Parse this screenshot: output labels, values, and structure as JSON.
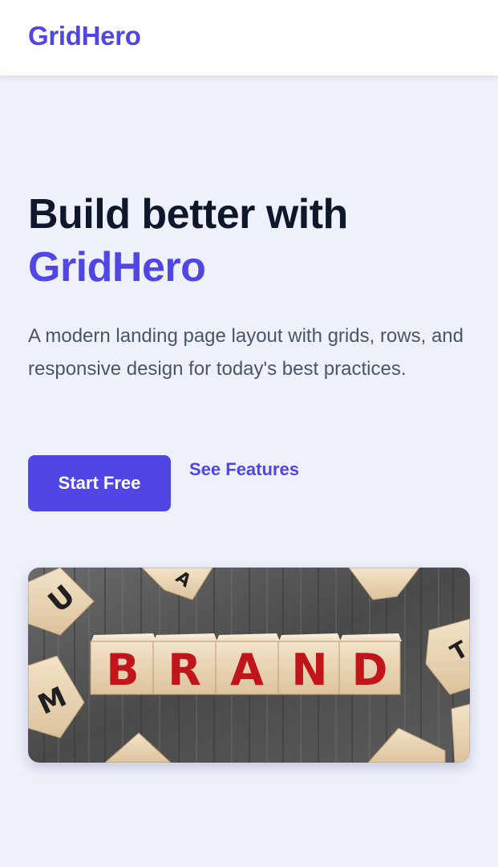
{
  "header": {
    "logo": "GridHero"
  },
  "hero": {
    "title_line1": "Build better with",
    "title_accent": "GridHero",
    "subtitle": "A modern landing page layout with grids, rows, and responsive design for today's best practices.",
    "primary_cta": "Start Free",
    "secondary_cta": "See Features"
  },
  "image": {
    "block_letters": [
      "B",
      "R",
      "A",
      "N",
      "D"
    ]
  },
  "colors": {
    "accent": "#4f46e5",
    "background": "#eef0fc",
    "heading": "#0f172a",
    "body_text": "#4b5563"
  }
}
